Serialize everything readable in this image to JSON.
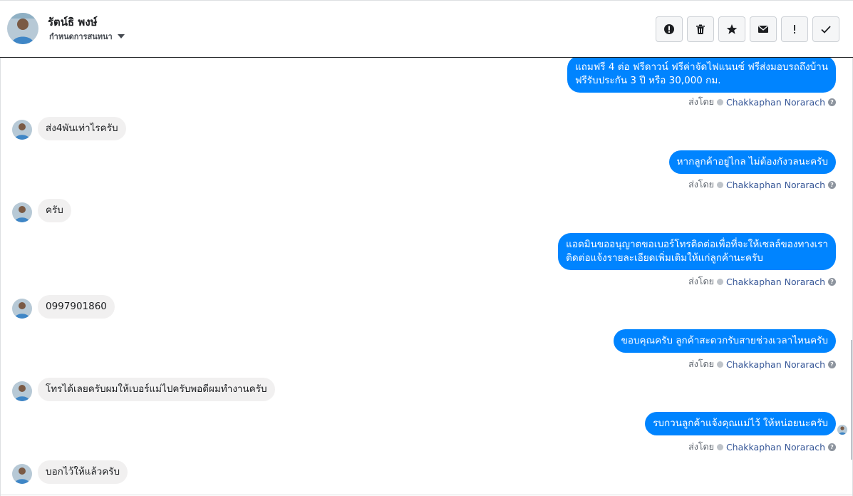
{
  "header": {
    "name": "รัตน์ธิ พงษ์",
    "subtitle": "กำหนดการสนทนา"
  },
  "toolbar": {
    "buttons": [
      {
        "icon": "alert-circle-icon",
        "label": "Spam"
      },
      {
        "icon": "trash-icon",
        "label": "Delete"
      },
      {
        "icon": "star-icon",
        "label": "Star"
      },
      {
        "icon": "envelope-icon",
        "label": "Mark as unread"
      },
      {
        "icon": "exclamation-icon",
        "label": "Follow up"
      },
      {
        "icon": "check-icon",
        "label": "Mark as done"
      }
    ]
  },
  "thread": {
    "sent_by_prefix": "ส่งโดย",
    "agent": "Chakkaphan Norarach",
    "messages": [
      {
        "dir": "out",
        "text": "แถมฟรี 4 ต่อ ฟรีดาวน์ ฟรีค่าจัดไฟแนนซ์ ฟรีส่งมอบรถถึงบ้าน\nฟรีรับประกัน 3 ปี หรือ 30,000 กม."
      },
      {
        "dir": "in",
        "text": "ส่ง4พันเท่าไรครับ"
      },
      {
        "dir": "out",
        "text": "หากลูกค้าอยู่ไกล ไม่ต้องกังวลนะครับ"
      },
      {
        "dir": "in",
        "text": "ครับ"
      },
      {
        "dir": "out",
        "text": "แอดมินขออนุญาตขอเบอร์โทรติดต่อเพื่อที่จะให้เซลล์ของทางเรา\nติดต่อแจ้งรายละเอียดเพิ่มเติมให้แก่ลูกค้านะครับ"
      },
      {
        "dir": "in",
        "text": "0997901860"
      },
      {
        "dir": "out",
        "text": "ขอบคุณครับ ลูกค้าสะดวกรับสายช่วงเวลาไหนครับ"
      },
      {
        "dir": "in",
        "text": "โทรได้เลยครับผมให้เบอร์แม่ไปครับพอดีผมทำงานครับ"
      },
      {
        "dir": "out",
        "text": "รบกวนลูกค้าแจ้งคุณแม่ไว้ ให้หน่อยนะครับ"
      },
      {
        "dir": "in",
        "text": "บอกไว้ให้แล้วครับ"
      }
    ]
  }
}
